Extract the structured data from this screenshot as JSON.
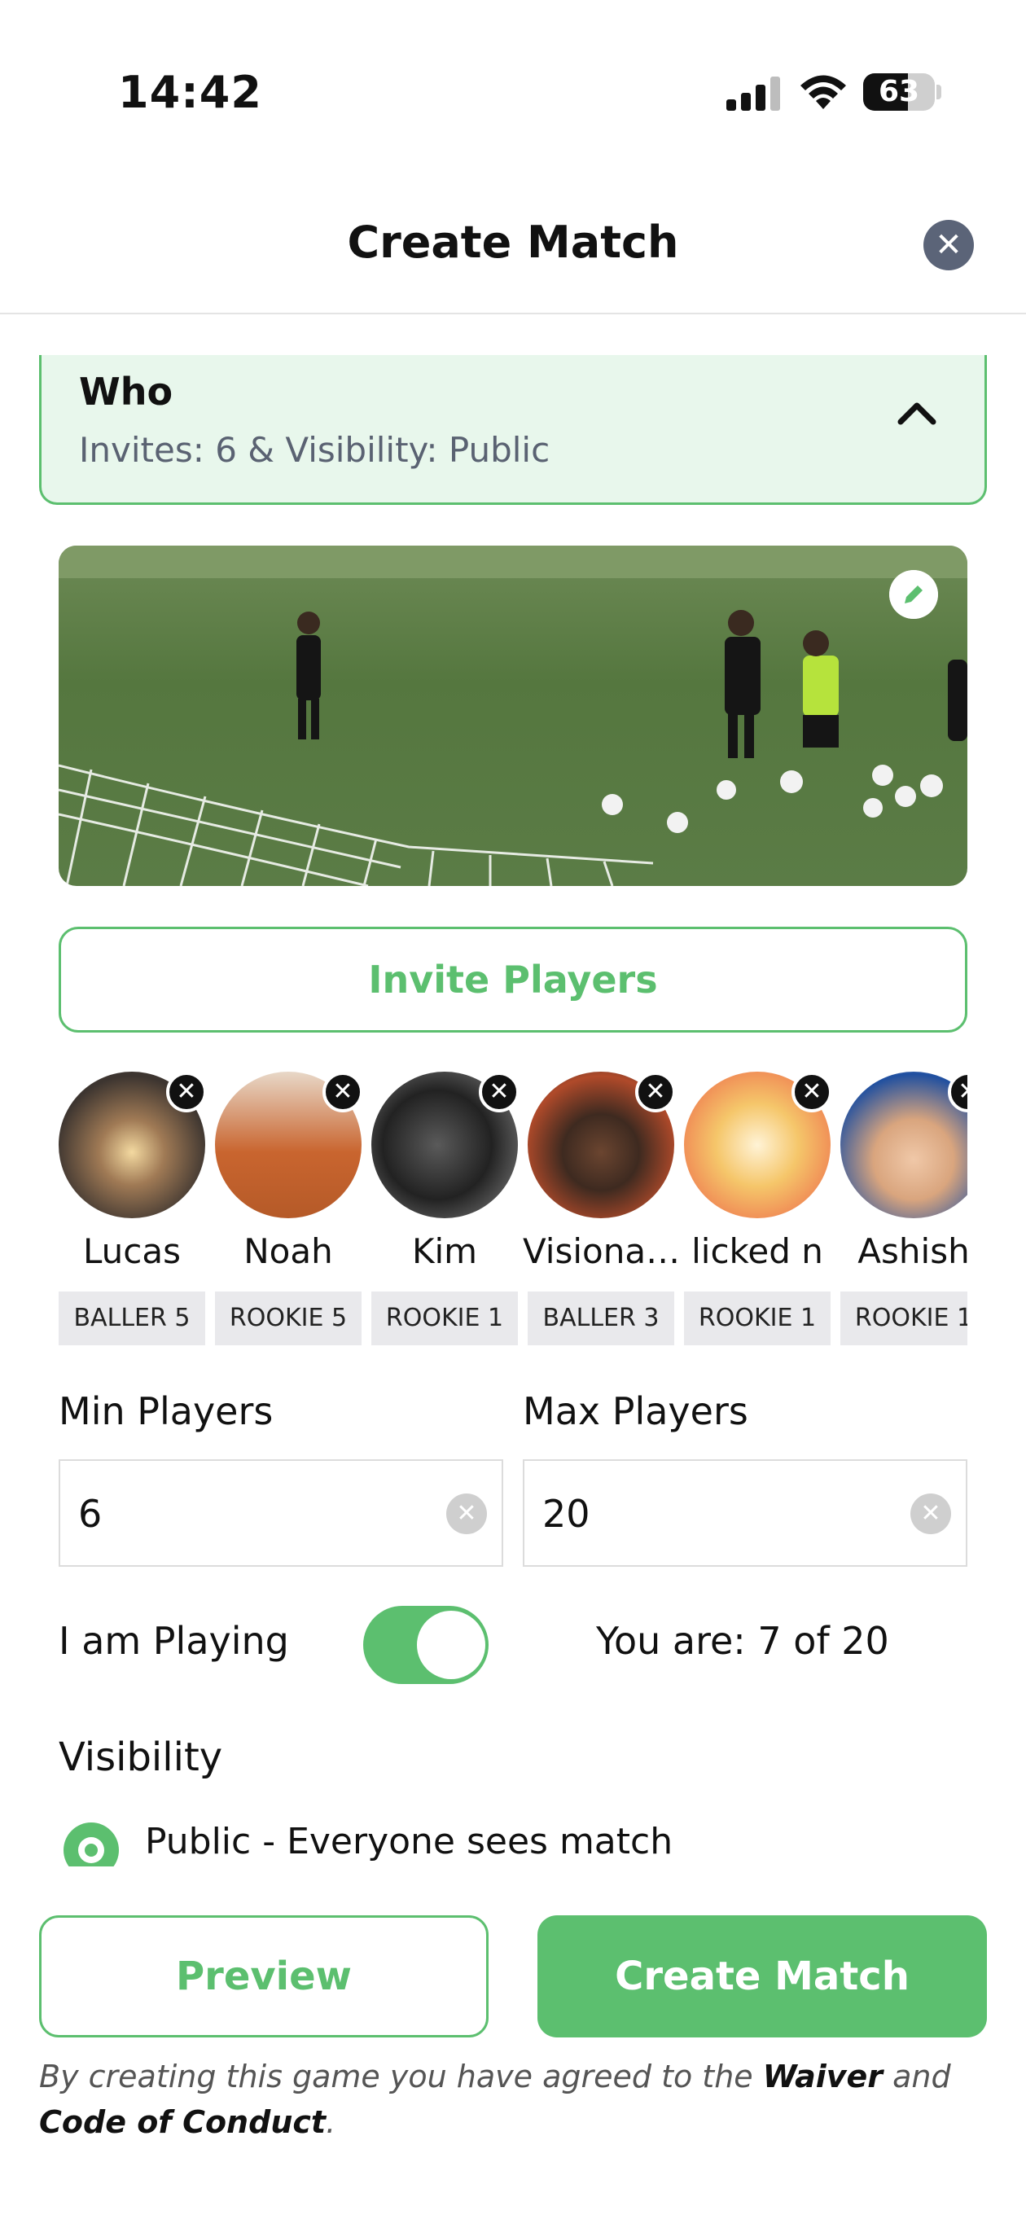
{
  "status_bar": {
    "time": "14:42",
    "battery": "63",
    "battery_level": 0.63
  },
  "header": {
    "title": "Create Match",
    "close_icon": "close-icon"
  },
  "who": {
    "title": "Who",
    "subtitle": "Invites: 6 & Visibility: Public"
  },
  "invite_button": "Invite Players",
  "players": [
    {
      "name": "Lucas",
      "badge": "BALLER 5"
    },
    {
      "name": "Noah",
      "badge": "ROOKIE 5"
    },
    {
      "name": "Kim",
      "badge": "ROOKIE 1"
    },
    {
      "name": "Visiona…",
      "badge": "BALLER 3"
    },
    {
      "name": "licked n",
      "badge": "ROOKIE 1"
    },
    {
      "name": "Ashish",
      "badge": "ROOKIE 1"
    }
  ],
  "min_players": {
    "label": "Min Players",
    "value": "6"
  },
  "max_players": {
    "label": "Max Players",
    "value": "20"
  },
  "playing": {
    "label": "I am Playing",
    "enabled": true,
    "status": "You are: 7 of 20"
  },
  "visibility": {
    "title": "Visibility",
    "option": "Public - Everyone sees match"
  },
  "buttons": {
    "preview": "Preview",
    "create": "Create Match"
  },
  "legal": {
    "prefix": "By creating this game you have agreed to the ",
    "waiver": "Waiver",
    "and": " and ",
    "conduct": "Code of Conduct",
    "suffix": "."
  },
  "colors": {
    "accent": "#5cbf6f",
    "who_bg": "#e8f7ec",
    "close_bg": "#5b6478"
  }
}
